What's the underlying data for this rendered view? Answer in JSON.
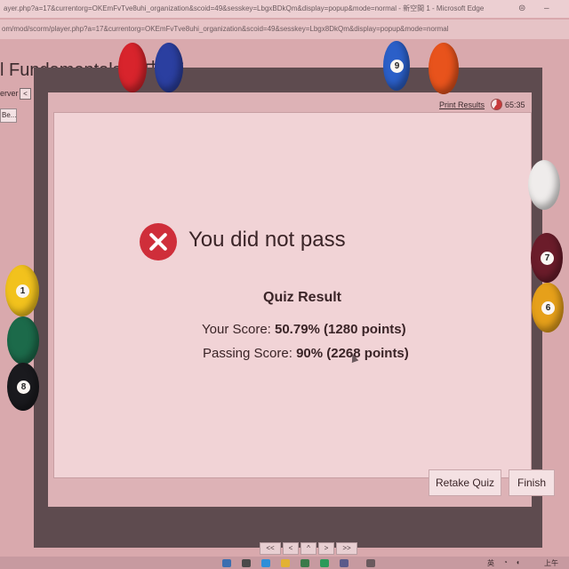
{
  "browser": {
    "title": "ayer.php?a=17&currentorg=OKEmFvTve8uhi_organization&scoid=49&sesskey=LbgxBDkQm&display=popup&mode=normal - 新空間 1 - Microsoft Edge",
    "url": "om/mod/scorm/player.php?a=17&currentorg=OKEmFvTve8uhi_organization&scoid=49&sesskey=Lbgx8DkQm&display=popup&mode=normal"
  },
  "course": {
    "title": "l Fundamentals 繁中 工",
    "server_label": "erver",
    "server_button": "<",
    "go_button": "Be..."
  },
  "player": {
    "print_results": "Print Results",
    "timer": "65:35"
  },
  "result": {
    "heading": "You did not pass",
    "section_title": "Quiz Result",
    "your_score_label": "Your Score:",
    "your_score_value": "50.79% (1280 points)",
    "passing_score_label": "Passing Score:",
    "passing_score_value": "90% (2268 points)"
  },
  "buttons": {
    "retake": "Retake Quiz",
    "finish": "Finish"
  },
  "pager": {
    "first": "<<",
    "prev": "<",
    "current": "^",
    "next": ">",
    "last": ">>"
  },
  "taskbar": {
    "lang": "英",
    "time": "上午"
  },
  "balls": {
    "one": "1",
    "six": "6",
    "seven": "7",
    "eight": "8",
    "nine": "9"
  },
  "colors": {
    "fail_red": "#cf2e3a",
    "card_bg": "#f1d3d6",
    "player_frame": "#5e4b4f"
  }
}
